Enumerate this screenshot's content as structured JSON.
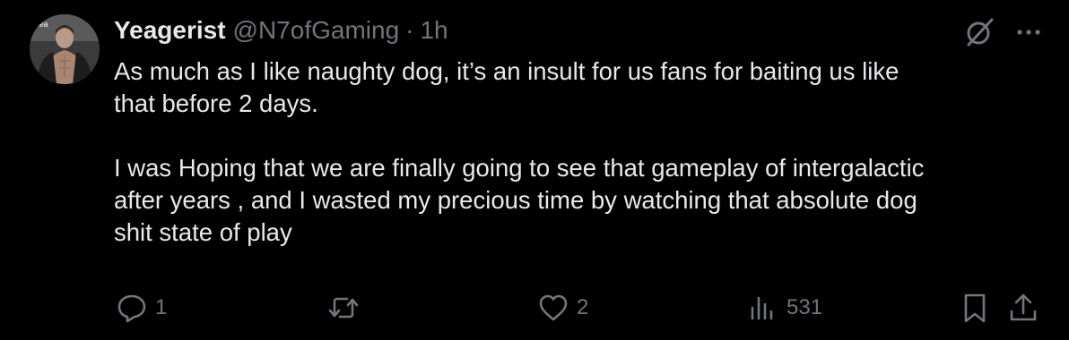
{
  "tweet": {
    "display_name": "Yeagerist",
    "handle": "@N7ofGaming",
    "separator": "·",
    "time": "1h",
    "avatar_overlay_text": "Rea",
    "body": {
      "paragraph1_line1": "As much as I like naughty dog, it’s an insult for us fans for baiting us like",
      "paragraph1_line2": "that before 2 days.",
      "paragraph2_line1": "I was Hoping that we are finally going to see that gameplay of intergalactic",
      "paragraph2_line2": "after years , and I wasted my precious time by watching that absolute dog",
      "paragraph2_line3": "shit state of play"
    },
    "actions": {
      "replies": "1",
      "reposts": "",
      "likes": "2",
      "views": "531"
    }
  },
  "icons": {
    "top": [
      "grok-slash-icon",
      "more-options-icon"
    ],
    "bottom": [
      "reply-icon",
      "repost-icon",
      "like-icon",
      "views-icon",
      "bookmark-icon",
      "share-icon"
    ]
  },
  "colors": {
    "background": "#000000",
    "primary_text": "#e7e9ea",
    "secondary_text": "#71767b"
  }
}
